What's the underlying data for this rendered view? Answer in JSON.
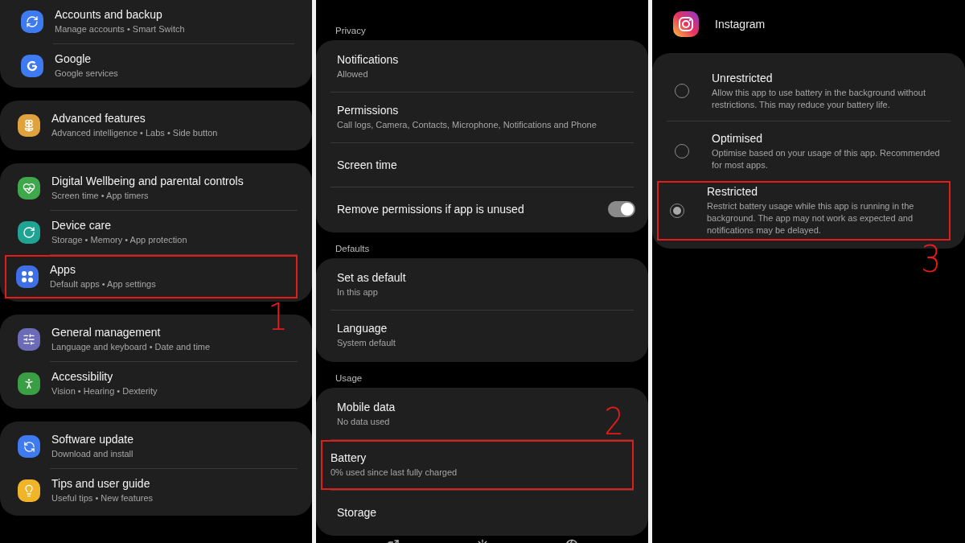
{
  "panels": [
    {
      "kind": "settings",
      "groups": [
        {
          "items": [
            {
              "title": "Accounts and backup",
              "subtitle": "Manage accounts • Smart Switch",
              "color": "#3e7bf0",
              "highlighted": false
            },
            {
              "title": "Google",
              "subtitle": "Google services",
              "color": "#3e7bf0",
              "highlighted": false
            }
          ]
        },
        {
          "items": [
            {
              "title": "Advanced features",
              "subtitle": "Advanced intelligence • Labs • Side button",
              "color": "#e0a23c",
              "highlighted": false
            }
          ]
        },
        {
          "items": [
            {
              "title": "Digital Wellbeing and parental controls",
              "subtitle": "Screen time • App timers",
              "color": "#3fa84a",
              "highlighted": false
            },
            {
              "title": "Device care",
              "subtitle": "Storage • Memory • App protection",
              "color": "#1fa392",
              "highlighted": false
            },
            {
              "title": "Apps",
              "subtitle": "Default apps • App settings",
              "color": "#3e6fe6",
              "highlighted": true,
              "annotation": {
                "text": "1"
              }
            }
          ]
        },
        {
          "items": [
            {
              "title": "General management",
              "subtitle": "Language and keyboard • Date and time",
              "color": "#6b6bb8",
              "highlighted": false
            },
            {
              "title": "Accessibility",
              "subtitle": "Vision • Hearing • Dexterity",
              "color": "#3a9e45",
              "highlighted": false
            }
          ]
        },
        {
          "items": [
            {
              "title": "Software update",
              "subtitle": "Download and install",
              "color": "#3e7bf0",
              "highlighted": false
            },
            {
              "title": "Tips and user guide",
              "subtitle": "Useful tips • New features",
              "color": "#f0b429",
              "highlighted": false
            }
          ]
        }
      ]
    },
    {
      "kind": "app_info",
      "sections": [
        {
          "label": "Privacy",
          "items": [
            {
              "title": "Notifications",
              "subtitle": "Allowed",
              "highlighted": false
            },
            {
              "title": "Permissions",
              "subtitle": "Call logs, Camera, Contacts, Microphone, Notifications and Phone",
              "highlighted": false
            },
            {
              "title": "Screen time",
              "highlighted": false
            },
            {
              "title": "Remove permissions if app is unused",
              "toggle": {
                "on": true
              },
              "highlighted": false
            }
          ]
        },
        {
          "label": "Defaults",
          "items": [
            {
              "title": "Set as default",
              "subtitle": "In this app",
              "highlighted": false
            },
            {
              "title": "Language",
              "subtitle": "System default",
              "highlighted": false
            }
          ]
        },
        {
          "label": "Usage",
          "items": [
            {
              "title": "Mobile data",
              "subtitle": "No data used",
              "highlighted": false
            },
            {
              "title": "Battery",
              "subtitle": "0% used since last fully charged",
              "highlighted": true,
              "annotation": {
                "text": "2"
              }
            },
            {
              "title": "Storage",
              "highlighted": false
            }
          ]
        }
      ]
    },
    {
      "kind": "battery",
      "app": {
        "name": "Instagram"
      },
      "options": [
        {
          "title": "Unrestricted",
          "description": "Allow this app to use battery in the background without restrictions. This may reduce your battery life.",
          "selected": false,
          "highlighted": false
        },
        {
          "title": "Optimised",
          "description": "Optimise based on your usage of this app. Recommended for most apps.",
          "selected": false,
          "highlighted": false
        },
        {
          "title": "Restricted",
          "description": "Restrict battery usage while this app is running in the background. The app may not work as expected and notifications may be delayed.",
          "selected": true,
          "highlighted": true,
          "annotation": {
            "text": "3"
          }
        }
      ]
    }
  ]
}
